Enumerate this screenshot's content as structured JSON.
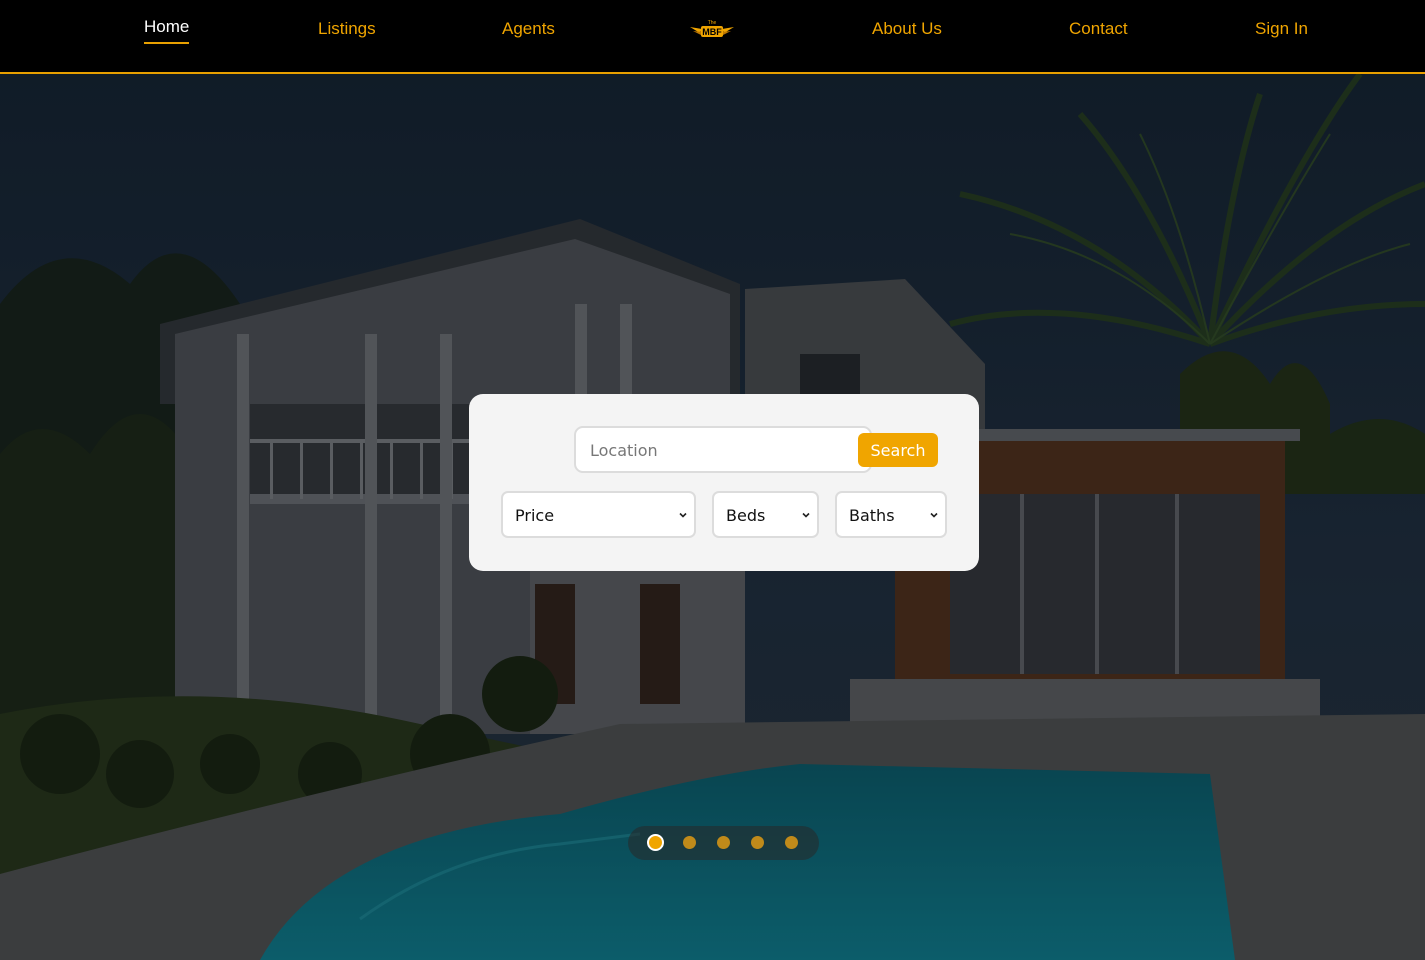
{
  "nav": {
    "items": [
      {
        "label": "Home",
        "active": true
      },
      {
        "label": "Listings",
        "active": false
      },
      {
        "label": "Agents",
        "active": false
      },
      {
        "label": "About Us",
        "active": false
      },
      {
        "label": "Contact",
        "active": false
      },
      {
        "label": "Sign In",
        "active": false
      }
    ],
    "logo": {
      "top_text": "The",
      "main_text": "MBF",
      "icon": "winged-logo-icon"
    }
  },
  "search": {
    "location_placeholder": "Location",
    "location_value": "",
    "button_label": "Search",
    "filters": [
      {
        "label": "Price",
        "icon": "chevron-down-icon"
      },
      {
        "label": "Beds",
        "icon": "chevron-down-icon"
      },
      {
        "label": "Baths",
        "icon": "chevron-down-icon"
      }
    ]
  },
  "carousel": {
    "slide_count": 5,
    "active_index": 0
  },
  "colors": {
    "accent": "#f0a500",
    "nav_bg": "#000000",
    "card_bg": "#f4f4f4"
  }
}
